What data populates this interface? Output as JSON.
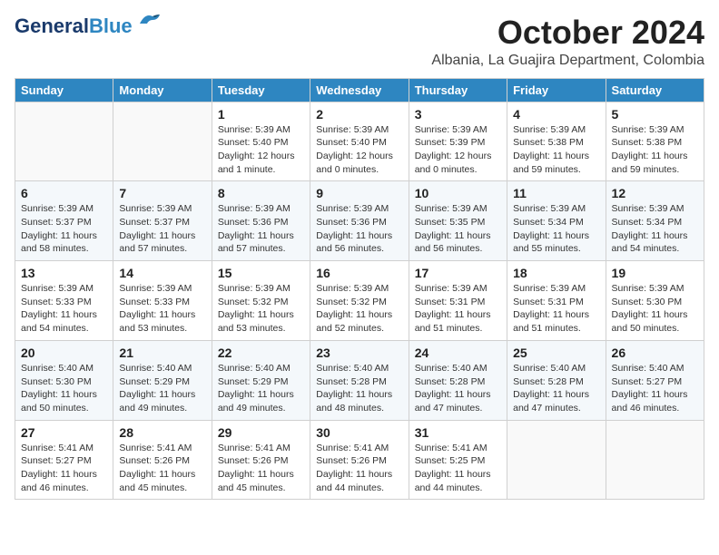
{
  "logo": {
    "text_general": "General",
    "text_blue": "Blue"
  },
  "title": {
    "month": "October 2024",
    "location": "Albania, La Guajira Department, Colombia"
  },
  "headers": [
    "Sunday",
    "Monday",
    "Tuesday",
    "Wednesday",
    "Thursday",
    "Friday",
    "Saturday"
  ],
  "weeks": [
    [
      {
        "day": "",
        "info": ""
      },
      {
        "day": "",
        "info": ""
      },
      {
        "day": "1",
        "info": "Sunrise: 5:39 AM\nSunset: 5:40 PM\nDaylight: 12 hours\nand 1 minute."
      },
      {
        "day": "2",
        "info": "Sunrise: 5:39 AM\nSunset: 5:40 PM\nDaylight: 12 hours\nand 0 minutes."
      },
      {
        "day": "3",
        "info": "Sunrise: 5:39 AM\nSunset: 5:39 PM\nDaylight: 12 hours\nand 0 minutes."
      },
      {
        "day": "4",
        "info": "Sunrise: 5:39 AM\nSunset: 5:38 PM\nDaylight: 11 hours\nand 59 minutes."
      },
      {
        "day": "5",
        "info": "Sunrise: 5:39 AM\nSunset: 5:38 PM\nDaylight: 11 hours\nand 59 minutes."
      }
    ],
    [
      {
        "day": "6",
        "info": "Sunrise: 5:39 AM\nSunset: 5:37 PM\nDaylight: 11 hours\nand 58 minutes."
      },
      {
        "day": "7",
        "info": "Sunrise: 5:39 AM\nSunset: 5:37 PM\nDaylight: 11 hours\nand 57 minutes."
      },
      {
        "day": "8",
        "info": "Sunrise: 5:39 AM\nSunset: 5:36 PM\nDaylight: 11 hours\nand 57 minutes."
      },
      {
        "day": "9",
        "info": "Sunrise: 5:39 AM\nSunset: 5:36 PM\nDaylight: 11 hours\nand 56 minutes."
      },
      {
        "day": "10",
        "info": "Sunrise: 5:39 AM\nSunset: 5:35 PM\nDaylight: 11 hours\nand 56 minutes."
      },
      {
        "day": "11",
        "info": "Sunrise: 5:39 AM\nSunset: 5:34 PM\nDaylight: 11 hours\nand 55 minutes."
      },
      {
        "day": "12",
        "info": "Sunrise: 5:39 AM\nSunset: 5:34 PM\nDaylight: 11 hours\nand 54 minutes."
      }
    ],
    [
      {
        "day": "13",
        "info": "Sunrise: 5:39 AM\nSunset: 5:33 PM\nDaylight: 11 hours\nand 54 minutes."
      },
      {
        "day": "14",
        "info": "Sunrise: 5:39 AM\nSunset: 5:33 PM\nDaylight: 11 hours\nand 53 minutes."
      },
      {
        "day": "15",
        "info": "Sunrise: 5:39 AM\nSunset: 5:32 PM\nDaylight: 11 hours\nand 53 minutes."
      },
      {
        "day": "16",
        "info": "Sunrise: 5:39 AM\nSunset: 5:32 PM\nDaylight: 11 hours\nand 52 minutes."
      },
      {
        "day": "17",
        "info": "Sunrise: 5:39 AM\nSunset: 5:31 PM\nDaylight: 11 hours\nand 51 minutes."
      },
      {
        "day": "18",
        "info": "Sunrise: 5:39 AM\nSunset: 5:31 PM\nDaylight: 11 hours\nand 51 minutes."
      },
      {
        "day": "19",
        "info": "Sunrise: 5:39 AM\nSunset: 5:30 PM\nDaylight: 11 hours\nand 50 minutes."
      }
    ],
    [
      {
        "day": "20",
        "info": "Sunrise: 5:40 AM\nSunset: 5:30 PM\nDaylight: 11 hours\nand 50 minutes."
      },
      {
        "day": "21",
        "info": "Sunrise: 5:40 AM\nSunset: 5:29 PM\nDaylight: 11 hours\nand 49 minutes."
      },
      {
        "day": "22",
        "info": "Sunrise: 5:40 AM\nSunset: 5:29 PM\nDaylight: 11 hours\nand 49 minutes."
      },
      {
        "day": "23",
        "info": "Sunrise: 5:40 AM\nSunset: 5:28 PM\nDaylight: 11 hours\nand 48 minutes."
      },
      {
        "day": "24",
        "info": "Sunrise: 5:40 AM\nSunset: 5:28 PM\nDaylight: 11 hours\nand 47 minutes."
      },
      {
        "day": "25",
        "info": "Sunrise: 5:40 AM\nSunset: 5:28 PM\nDaylight: 11 hours\nand 47 minutes."
      },
      {
        "day": "26",
        "info": "Sunrise: 5:40 AM\nSunset: 5:27 PM\nDaylight: 11 hours\nand 46 minutes."
      }
    ],
    [
      {
        "day": "27",
        "info": "Sunrise: 5:41 AM\nSunset: 5:27 PM\nDaylight: 11 hours\nand 46 minutes."
      },
      {
        "day": "28",
        "info": "Sunrise: 5:41 AM\nSunset: 5:26 PM\nDaylight: 11 hours\nand 45 minutes."
      },
      {
        "day": "29",
        "info": "Sunrise: 5:41 AM\nSunset: 5:26 PM\nDaylight: 11 hours\nand 45 minutes."
      },
      {
        "day": "30",
        "info": "Sunrise: 5:41 AM\nSunset: 5:26 PM\nDaylight: 11 hours\nand 44 minutes."
      },
      {
        "day": "31",
        "info": "Sunrise: 5:41 AM\nSunset: 5:25 PM\nDaylight: 11 hours\nand 44 minutes."
      },
      {
        "day": "",
        "info": ""
      },
      {
        "day": "",
        "info": ""
      }
    ]
  ]
}
